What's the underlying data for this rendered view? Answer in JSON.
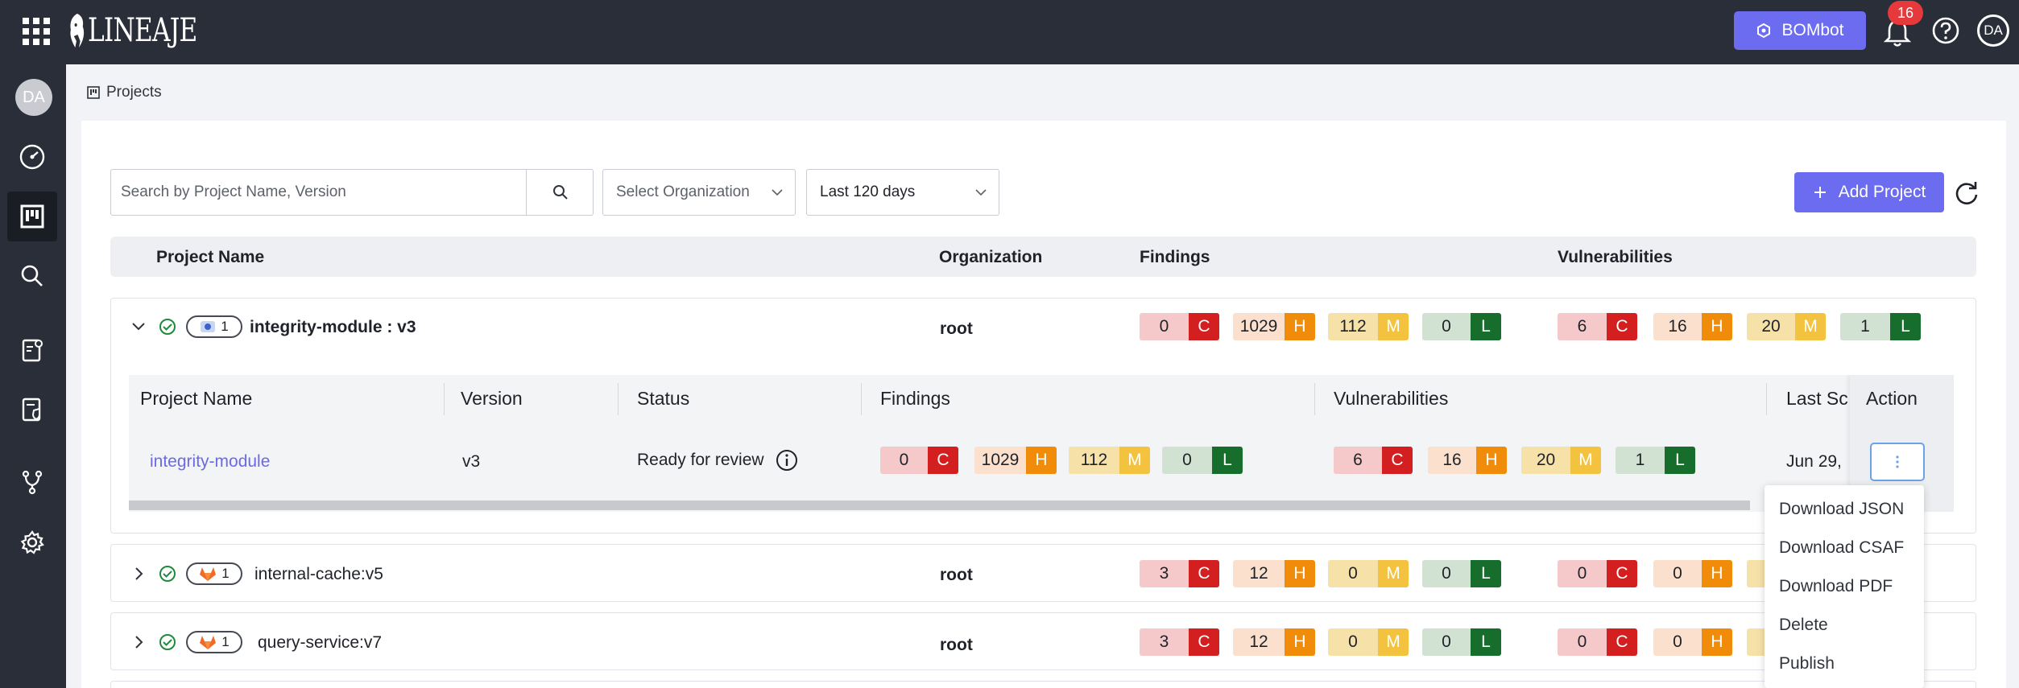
{
  "app": {
    "logo_text": "LINEAJE"
  },
  "topbar": {
    "bombot_label": "BOMbot",
    "notification_count": "16",
    "user_initials": "DA"
  },
  "sidebar": {
    "user_initials": "DA"
  },
  "breadcrumb": {
    "label": "Projects"
  },
  "toolbar": {
    "search_placeholder": "Search by Project Name, Version",
    "org_select": "Select Organization",
    "date_select": "Last 120 days",
    "add_label": "Add Project"
  },
  "table": {
    "headers": {
      "project": "Project Name",
      "org": "Organization",
      "findings": "Findings",
      "vulns": "Vulnerabilities"
    },
    "rows": [
      {
        "count": "1",
        "name": "integrity-module : v3",
        "org": "root",
        "findings": [
          "0",
          "1029",
          "112",
          "0"
        ],
        "vulns": [
          "6",
          "16",
          "20",
          "1"
        ]
      },
      {
        "count": "1",
        "name": "internal-cache:v5",
        "org": "root",
        "findings": [
          "3",
          "12",
          "0",
          "0"
        ],
        "vulns": [
          "0",
          "0"
        ]
      },
      {
        "count": "1",
        "name": "query-service:v7",
        "org": "root",
        "findings": [
          "3",
          "12",
          "0",
          "0"
        ],
        "vulns": [
          "0",
          "0"
        ]
      }
    ]
  },
  "severity_letters": {
    "c": "C",
    "h": "H",
    "m": "M",
    "l": "L"
  },
  "subtable": {
    "headers": {
      "project": "Project Name",
      "version": "Version",
      "status": "Status",
      "findings": "Findings",
      "vulns": "Vulnerabilities",
      "last_scan": "Last Sc",
      "action": "Action"
    },
    "row": {
      "name": "integrity-module",
      "version": "v3",
      "status": "Ready for review",
      "findings": [
        "0",
        "1029",
        "112",
        "0"
      ],
      "vulns": [
        "6",
        "16",
        "20",
        "1"
      ],
      "last_scan": "Jun 29,"
    }
  },
  "action_menu": [
    "Download JSON",
    "Download CSAF",
    "Download PDF",
    "Delete",
    "Publish"
  ],
  "colors": {
    "accent": "#6c6cf0",
    "critical": "#d31f1f",
    "high": "#f08c09",
    "medium": "#f3c340",
    "low": "#176d2b"
  }
}
